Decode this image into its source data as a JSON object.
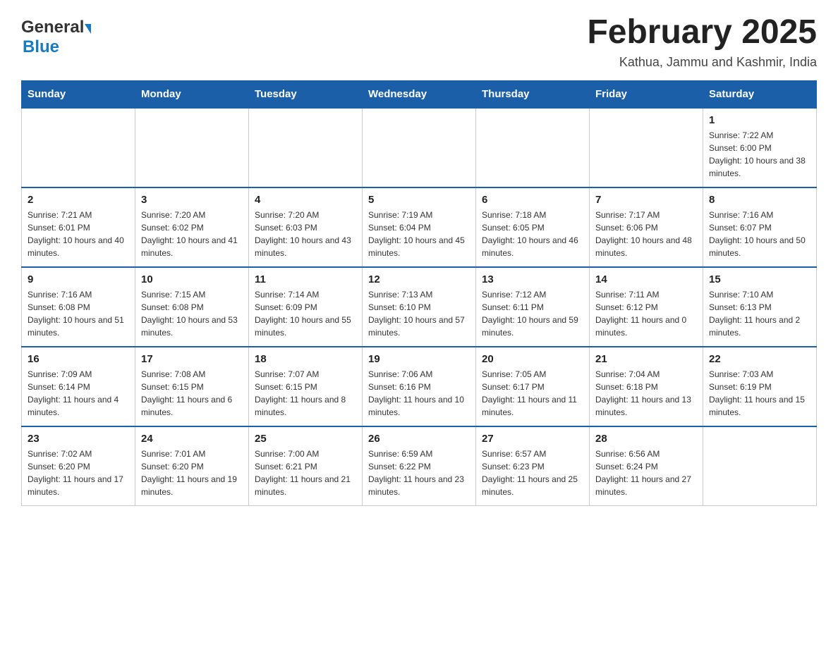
{
  "header": {
    "logo_general": "General",
    "logo_blue": "Blue",
    "month_year": "February 2025",
    "location": "Kathua, Jammu and Kashmir, India"
  },
  "weekdays": [
    "Sunday",
    "Monday",
    "Tuesday",
    "Wednesday",
    "Thursday",
    "Friday",
    "Saturday"
  ],
  "weeks": [
    [
      {
        "day": "",
        "sunrise": "",
        "sunset": "",
        "daylight": ""
      },
      {
        "day": "",
        "sunrise": "",
        "sunset": "",
        "daylight": ""
      },
      {
        "day": "",
        "sunrise": "",
        "sunset": "",
        "daylight": ""
      },
      {
        "day": "",
        "sunrise": "",
        "sunset": "",
        "daylight": ""
      },
      {
        "day": "",
        "sunrise": "",
        "sunset": "",
        "daylight": ""
      },
      {
        "day": "",
        "sunrise": "",
        "sunset": "",
        "daylight": ""
      },
      {
        "day": "1",
        "sunrise": "Sunrise: 7:22 AM",
        "sunset": "Sunset: 6:00 PM",
        "daylight": "Daylight: 10 hours and 38 minutes."
      }
    ],
    [
      {
        "day": "2",
        "sunrise": "Sunrise: 7:21 AM",
        "sunset": "Sunset: 6:01 PM",
        "daylight": "Daylight: 10 hours and 40 minutes."
      },
      {
        "day": "3",
        "sunrise": "Sunrise: 7:20 AM",
        "sunset": "Sunset: 6:02 PM",
        "daylight": "Daylight: 10 hours and 41 minutes."
      },
      {
        "day": "4",
        "sunrise": "Sunrise: 7:20 AM",
        "sunset": "Sunset: 6:03 PM",
        "daylight": "Daylight: 10 hours and 43 minutes."
      },
      {
        "day": "5",
        "sunrise": "Sunrise: 7:19 AM",
        "sunset": "Sunset: 6:04 PM",
        "daylight": "Daylight: 10 hours and 45 minutes."
      },
      {
        "day": "6",
        "sunrise": "Sunrise: 7:18 AM",
        "sunset": "Sunset: 6:05 PM",
        "daylight": "Daylight: 10 hours and 46 minutes."
      },
      {
        "day": "7",
        "sunrise": "Sunrise: 7:17 AM",
        "sunset": "Sunset: 6:06 PM",
        "daylight": "Daylight: 10 hours and 48 minutes."
      },
      {
        "day": "8",
        "sunrise": "Sunrise: 7:16 AM",
        "sunset": "Sunset: 6:07 PM",
        "daylight": "Daylight: 10 hours and 50 minutes."
      }
    ],
    [
      {
        "day": "9",
        "sunrise": "Sunrise: 7:16 AM",
        "sunset": "Sunset: 6:08 PM",
        "daylight": "Daylight: 10 hours and 51 minutes."
      },
      {
        "day": "10",
        "sunrise": "Sunrise: 7:15 AM",
        "sunset": "Sunset: 6:08 PM",
        "daylight": "Daylight: 10 hours and 53 minutes."
      },
      {
        "day": "11",
        "sunrise": "Sunrise: 7:14 AM",
        "sunset": "Sunset: 6:09 PM",
        "daylight": "Daylight: 10 hours and 55 minutes."
      },
      {
        "day": "12",
        "sunrise": "Sunrise: 7:13 AM",
        "sunset": "Sunset: 6:10 PM",
        "daylight": "Daylight: 10 hours and 57 minutes."
      },
      {
        "day": "13",
        "sunrise": "Sunrise: 7:12 AM",
        "sunset": "Sunset: 6:11 PM",
        "daylight": "Daylight: 10 hours and 59 minutes."
      },
      {
        "day": "14",
        "sunrise": "Sunrise: 7:11 AM",
        "sunset": "Sunset: 6:12 PM",
        "daylight": "Daylight: 11 hours and 0 minutes."
      },
      {
        "day": "15",
        "sunrise": "Sunrise: 7:10 AM",
        "sunset": "Sunset: 6:13 PM",
        "daylight": "Daylight: 11 hours and 2 minutes."
      }
    ],
    [
      {
        "day": "16",
        "sunrise": "Sunrise: 7:09 AM",
        "sunset": "Sunset: 6:14 PM",
        "daylight": "Daylight: 11 hours and 4 minutes."
      },
      {
        "day": "17",
        "sunrise": "Sunrise: 7:08 AM",
        "sunset": "Sunset: 6:15 PM",
        "daylight": "Daylight: 11 hours and 6 minutes."
      },
      {
        "day": "18",
        "sunrise": "Sunrise: 7:07 AM",
        "sunset": "Sunset: 6:15 PM",
        "daylight": "Daylight: 11 hours and 8 minutes."
      },
      {
        "day": "19",
        "sunrise": "Sunrise: 7:06 AM",
        "sunset": "Sunset: 6:16 PM",
        "daylight": "Daylight: 11 hours and 10 minutes."
      },
      {
        "day": "20",
        "sunrise": "Sunrise: 7:05 AM",
        "sunset": "Sunset: 6:17 PM",
        "daylight": "Daylight: 11 hours and 11 minutes."
      },
      {
        "day": "21",
        "sunrise": "Sunrise: 7:04 AM",
        "sunset": "Sunset: 6:18 PM",
        "daylight": "Daylight: 11 hours and 13 minutes."
      },
      {
        "day": "22",
        "sunrise": "Sunrise: 7:03 AM",
        "sunset": "Sunset: 6:19 PM",
        "daylight": "Daylight: 11 hours and 15 minutes."
      }
    ],
    [
      {
        "day": "23",
        "sunrise": "Sunrise: 7:02 AM",
        "sunset": "Sunset: 6:20 PM",
        "daylight": "Daylight: 11 hours and 17 minutes."
      },
      {
        "day": "24",
        "sunrise": "Sunrise: 7:01 AM",
        "sunset": "Sunset: 6:20 PM",
        "daylight": "Daylight: 11 hours and 19 minutes."
      },
      {
        "day": "25",
        "sunrise": "Sunrise: 7:00 AM",
        "sunset": "Sunset: 6:21 PM",
        "daylight": "Daylight: 11 hours and 21 minutes."
      },
      {
        "day": "26",
        "sunrise": "Sunrise: 6:59 AM",
        "sunset": "Sunset: 6:22 PM",
        "daylight": "Daylight: 11 hours and 23 minutes."
      },
      {
        "day": "27",
        "sunrise": "Sunrise: 6:57 AM",
        "sunset": "Sunset: 6:23 PM",
        "daylight": "Daylight: 11 hours and 25 minutes."
      },
      {
        "day": "28",
        "sunrise": "Sunrise: 6:56 AM",
        "sunset": "Sunset: 6:24 PM",
        "daylight": "Daylight: 11 hours and 27 minutes."
      },
      {
        "day": "",
        "sunrise": "",
        "sunset": "",
        "daylight": ""
      }
    ]
  ]
}
